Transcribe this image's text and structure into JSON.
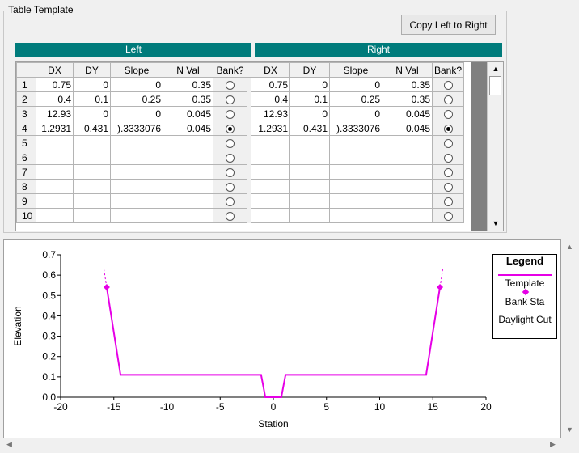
{
  "group_title": "Table Template",
  "copy_button": "Copy Left to Right",
  "left_header": "Left",
  "right_header": "Right",
  "columns": [
    "DX",
    "DY",
    "Slope",
    "N Val",
    "Bank?"
  ],
  "rows": [
    {
      "n": "1",
      "left": [
        "0.75",
        "0",
        "0",
        "0.35"
      ],
      "left_bank": false,
      "right": [
        "0.75",
        "0",
        "0",
        "0.35"
      ],
      "right_bank": false
    },
    {
      "n": "2",
      "left": [
        "0.4",
        "0.1",
        "0.25",
        "0.35"
      ],
      "left_bank": false,
      "right": [
        "0.4",
        "0.1",
        "0.25",
        "0.35"
      ],
      "right_bank": false
    },
    {
      "n": "3",
      "left": [
        "12.93",
        "0",
        "0",
        "0.045"
      ],
      "left_bank": false,
      "right": [
        "12.93",
        "0",
        "0",
        "0.045"
      ],
      "right_bank": false
    },
    {
      "n": "4",
      "left": [
        "1.2931",
        "0.431",
        ").3333076",
        "0.045"
      ],
      "left_bank": true,
      "right": [
        "1.2931",
        "0.431",
        ").3333076",
        "0.045"
      ],
      "right_bank": true
    },
    {
      "n": "5",
      "left": [
        "",
        "",
        "",
        ""
      ],
      "left_bank": false,
      "right": [
        "",
        "",
        "",
        ""
      ],
      "right_bank": false
    },
    {
      "n": "6",
      "left": [
        "",
        "",
        "",
        ""
      ],
      "left_bank": false,
      "right": [
        "",
        "",
        "",
        ""
      ],
      "right_bank": false
    },
    {
      "n": "7",
      "left": [
        "",
        "",
        "",
        ""
      ],
      "left_bank": false,
      "right": [
        "",
        "",
        "",
        ""
      ],
      "right_bank": false
    },
    {
      "n": "8",
      "left": [
        "",
        "",
        "",
        ""
      ],
      "left_bank": false,
      "right": [
        "",
        "",
        "",
        ""
      ],
      "right_bank": false
    },
    {
      "n": "9",
      "left": [
        "",
        "",
        "",
        ""
      ],
      "left_bank": false,
      "right": [
        "",
        "",
        "",
        ""
      ],
      "right_bank": false
    },
    {
      "n": "10",
      "left": [
        "",
        "",
        "",
        ""
      ],
      "left_bank": false,
      "right": [
        "",
        "",
        "",
        ""
      ],
      "right_bank": false
    }
  ],
  "chart_data": {
    "type": "line",
    "xlabel": "Station",
    "ylabel": "Elevation",
    "xlim": [
      -20,
      20
    ],
    "ylim": [
      0,
      0.7
    ],
    "xticks": [
      "-20",
      "-15",
      "-10",
      "-5",
      "0",
      "5",
      "10",
      "15",
      "20"
    ],
    "yticks": [
      "0.0",
      "0.1",
      "0.2",
      "0.3",
      "0.4",
      "0.5",
      "0.6",
      "0.7"
    ],
    "legend_title": "Legend",
    "series": [
      {
        "name": "Template",
        "color": "#e600e6",
        "x": [
          -15.67,
          -14.37,
          -1.15,
          -0.75,
          0.75,
          1.15,
          14.37,
          15.67
        ],
        "y": [
          0.541,
          0.11,
          0.11,
          0,
          0,
          0.11,
          0.11,
          0.541
        ]
      },
      {
        "name": "Bank Sta",
        "color": "#e600e6",
        "x": [
          -15.67,
          15.67
        ],
        "y": [
          0.541,
          0.541
        ]
      },
      {
        "name": "Daylight Cut",
        "color": "#e600e6",
        "segments": [
          [
            [
              -15.67,
              0.541
            ],
            [
              -15.95,
              0.635
            ]
          ],
          [
            [
              15.67,
              0.541
            ],
            [
              15.95,
              0.635
            ]
          ]
        ]
      }
    ]
  }
}
